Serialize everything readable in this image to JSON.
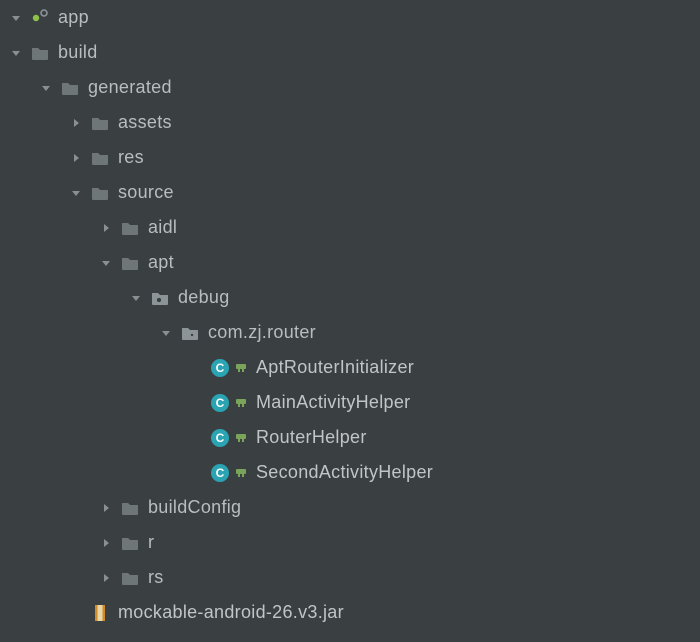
{
  "indentUnit": 30,
  "baseIndent": 8,
  "colors": {
    "arrow": "#8a8f91",
    "folder": "#6f7678",
    "folderLight": "#8c9497",
    "classCircle": "#2aa3b3",
    "classLetter": "#ffffff",
    "gen": "#7aa45a",
    "jarOuter": "#d08a2a",
    "jarInner": "#e6d6a8",
    "appDot": "#8dc149",
    "text": "#b8bdbf"
  },
  "nodes": [
    {
      "depth": 0,
      "arrow": "down",
      "icon": "app",
      "label": "app"
    },
    {
      "depth": 0,
      "arrow": "down",
      "icon": "folder",
      "label": "build"
    },
    {
      "depth": 1,
      "arrow": "down",
      "icon": "folder",
      "label": "generated"
    },
    {
      "depth": 2,
      "arrow": "right",
      "icon": "folder",
      "label": "assets"
    },
    {
      "depth": 2,
      "arrow": "right",
      "icon": "folder",
      "label": "res"
    },
    {
      "depth": 2,
      "arrow": "down",
      "icon": "folder",
      "label": "source"
    },
    {
      "depth": 3,
      "arrow": "right",
      "icon": "folder",
      "label": "aidl"
    },
    {
      "depth": 3,
      "arrow": "down",
      "icon": "folder",
      "label": "apt"
    },
    {
      "depth": 4,
      "arrow": "down",
      "icon": "gen-folder",
      "label": "debug"
    },
    {
      "depth": 5,
      "arrow": "down",
      "icon": "package",
      "label": "com.zj.router"
    },
    {
      "depth": 6,
      "arrow": "none",
      "icon": "class",
      "overlay": "gen",
      "label": "AptRouterInitializer"
    },
    {
      "depth": 6,
      "arrow": "none",
      "icon": "class",
      "overlay": "gen",
      "label": "MainActivityHelper"
    },
    {
      "depth": 6,
      "arrow": "none",
      "icon": "class",
      "overlay": "gen",
      "label": "RouterHelper"
    },
    {
      "depth": 6,
      "arrow": "none",
      "icon": "class",
      "overlay": "gen",
      "label": "SecondActivityHelper"
    },
    {
      "depth": 3,
      "arrow": "right",
      "icon": "folder",
      "label": "buildConfig"
    },
    {
      "depth": 3,
      "arrow": "right",
      "icon": "folder",
      "label": "r"
    },
    {
      "depth": 3,
      "arrow": "right",
      "icon": "folder",
      "label": "rs"
    },
    {
      "depth": 2,
      "arrow": "none",
      "icon": "jar",
      "label": "mockable-android-26.v3.jar"
    }
  ]
}
